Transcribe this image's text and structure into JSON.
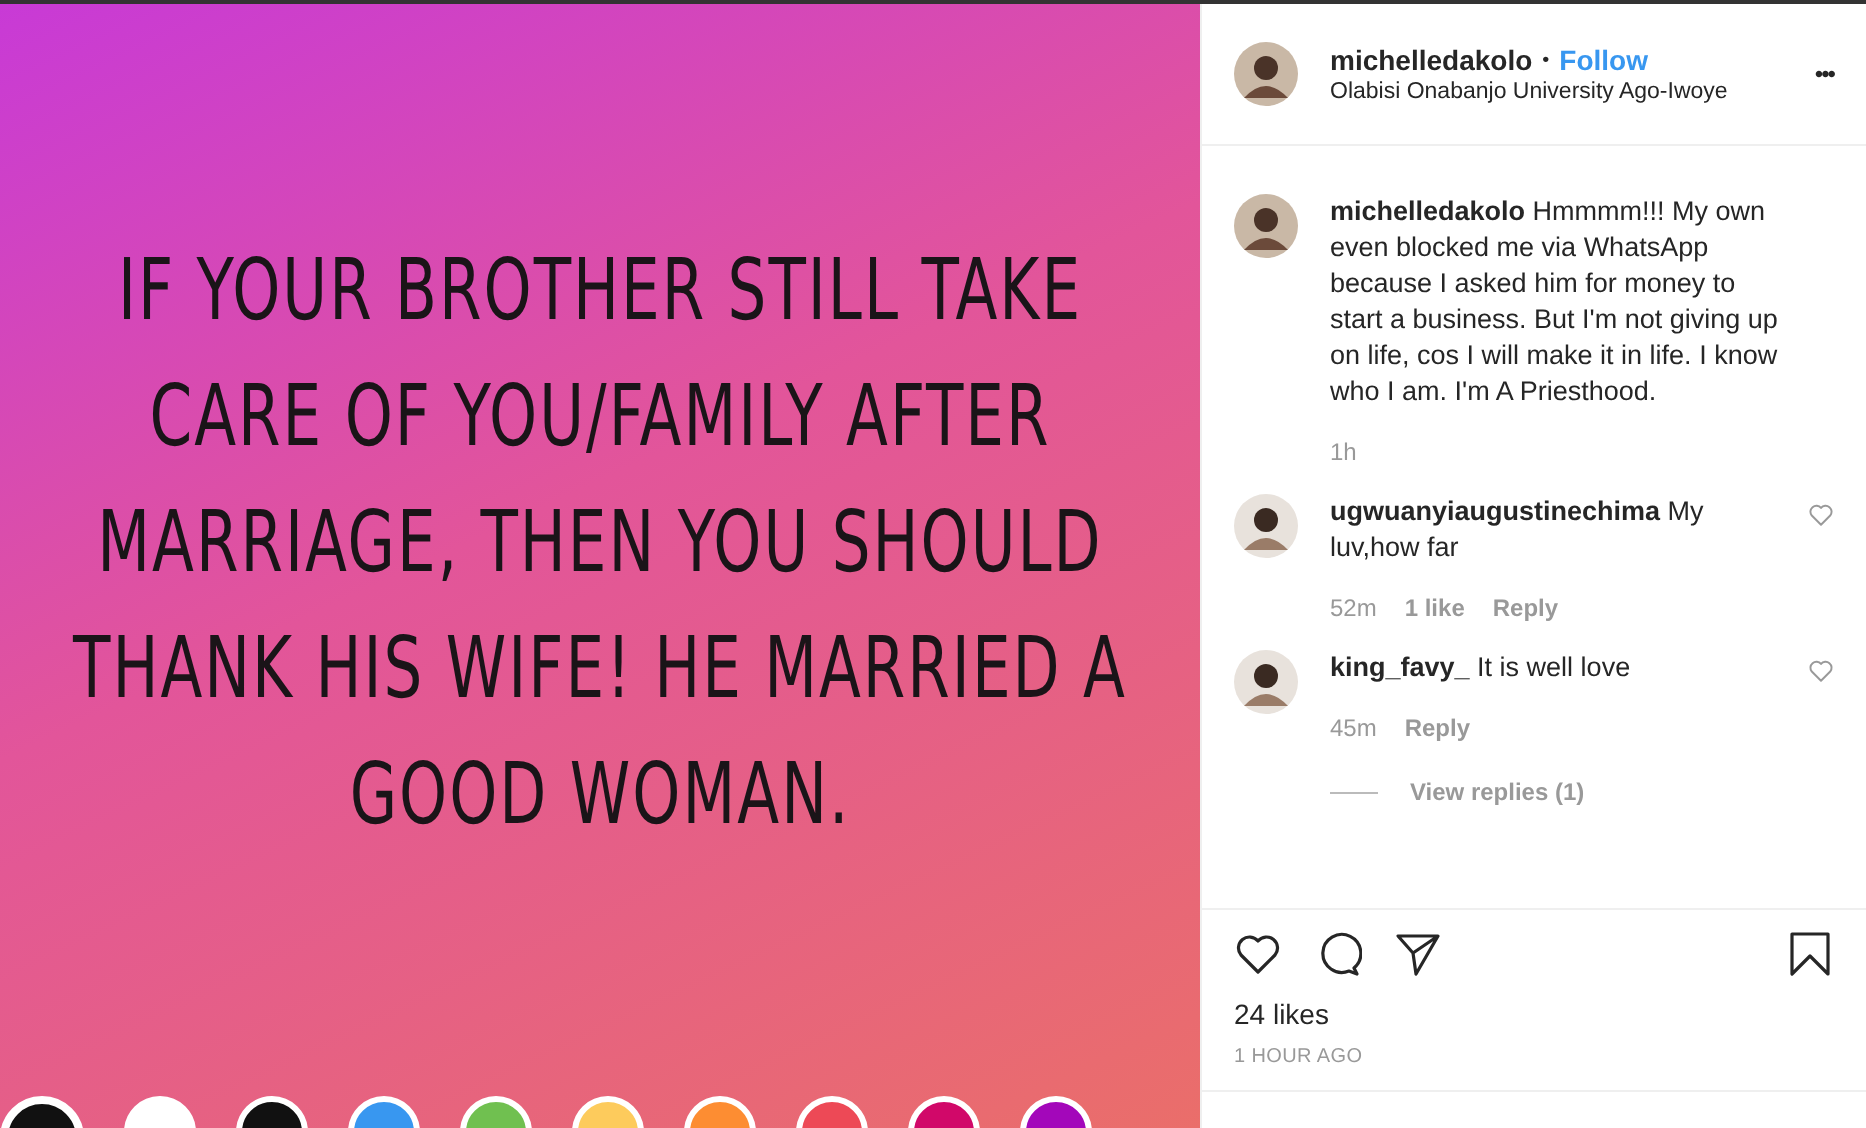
{
  "post_image": {
    "lines": [
      "IF YOUR BROTHER STILL TAKE",
      "CARE OF YOU/FAMILY AFTER",
      "MARRIAGE, THEN YOU SHOULD",
      "THANK HIS WIFE! HE MARRIED A",
      "GOOD WOMAN."
    ],
    "color_swatches": [
      {
        "color": "#111111",
        "selected": true
      },
      {
        "color": "#ffffff",
        "selected": false
      },
      {
        "color": "#111111",
        "selected": false
      },
      {
        "color": "#3897f0",
        "selected": false
      },
      {
        "color": "#70c050",
        "selected": false
      },
      {
        "color": "#fdcb5c",
        "selected": false
      },
      {
        "color": "#fd8d32",
        "selected": false
      },
      {
        "color": "#ed4956",
        "selected": false
      },
      {
        "color": "#d10869",
        "selected": false
      },
      {
        "color": "#a307ba",
        "selected": false
      }
    ]
  },
  "header": {
    "username": "michelledakolo",
    "separator": "•",
    "follow": "Follow",
    "location": "Olabisi Onabanjo University Ago-Iwoye",
    "more": "•••"
  },
  "caption": {
    "username": "michelledakolo",
    "text": "Hmmmm!!! My own even blocked me via WhatsApp because I asked him for money to start a business. But I'm not giving up on life, cos I will make it in life. I know who I am. I'm A Priesthood.",
    "time": "1h"
  },
  "comments": [
    {
      "username": "ugwuanyiaugustinechima",
      "text": "My luv,how far",
      "time": "52m",
      "likes": "1 like",
      "reply": "Reply"
    },
    {
      "username": "king_favy_",
      "text": "It is well love",
      "time": "45m",
      "reply": "Reply",
      "view_replies": "View replies (1)"
    }
  ],
  "likes": "24 likes",
  "timestamp": "1 HOUR AGO"
}
